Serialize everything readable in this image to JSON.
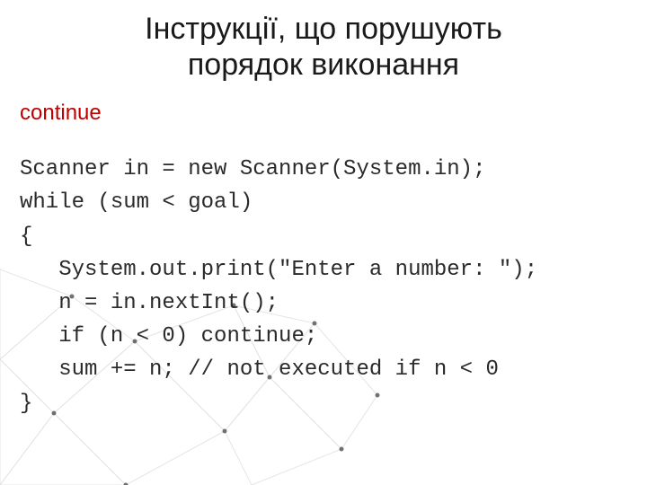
{
  "title_line1": "Інструкції, що порушують",
  "title_line2": "порядок виконання",
  "keyword": "continue",
  "code": {
    "l1": "Scanner in = new Scanner(System.in);",
    "l2": "while (sum < goal)",
    "l3": "{",
    "l4": "   System.out.print(\"Enter a number: \");",
    "l5": "   n = in.nextInt();",
    "l6": "   if (n < 0) continue;",
    "l7": "   sum += n; // not executed if n < 0",
    "l8": "}"
  }
}
